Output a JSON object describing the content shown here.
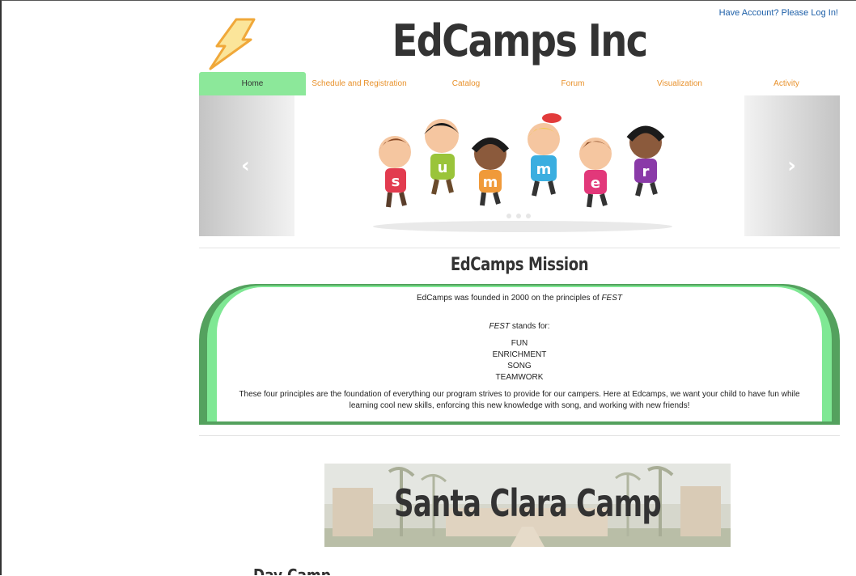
{
  "header": {
    "login_link": "Have Account? Please Log In!",
    "title": "EdCamps Inc",
    "logo_icon": "lightning-bolt-icon"
  },
  "nav": {
    "items": [
      {
        "label": "Home",
        "active": true
      },
      {
        "label": "Schedule and Registration",
        "active": false
      },
      {
        "label": "Catalog",
        "active": false
      },
      {
        "label": "Forum",
        "active": false
      },
      {
        "label": "Visualization",
        "active": false
      },
      {
        "label": "Activity",
        "active": false
      }
    ]
  },
  "carousel": {
    "image": "summer-kids-illustration",
    "prev_icon": "chevron-left-icon",
    "next_icon": "chevron-right-icon",
    "letters": [
      "s",
      "u",
      "m",
      "m",
      "e",
      "r"
    ]
  },
  "mission": {
    "title": "EdCamps Mission",
    "founded_prefix": "EdCamps was founded in 2000 on the principles of ",
    "fest": "FEST",
    "stands_for_suffix": " stands for:",
    "principles": [
      "FUN",
      "ENRICHMENT",
      "SONG",
      "TEAMWORK"
    ],
    "paragraph_line1": "These four principles are the foundation of everything our program strives to provide for our campers. Here at Edcamps, we want your child to have fun while",
    "paragraph_line2": "learning cool new skills, enforcing this new knowledge with song, and working with new friends!"
  },
  "camp": {
    "title": "Santa Clara Camp"
  },
  "section": {
    "day_camp": "Day Camp"
  },
  "colors": {
    "nav_active": "#8ce89a",
    "nav_link": "#e8912b",
    "login_link": "#1d5fa8",
    "mission_border_dark": "#54a15e",
    "mission_border_light": "#7fe894"
  }
}
